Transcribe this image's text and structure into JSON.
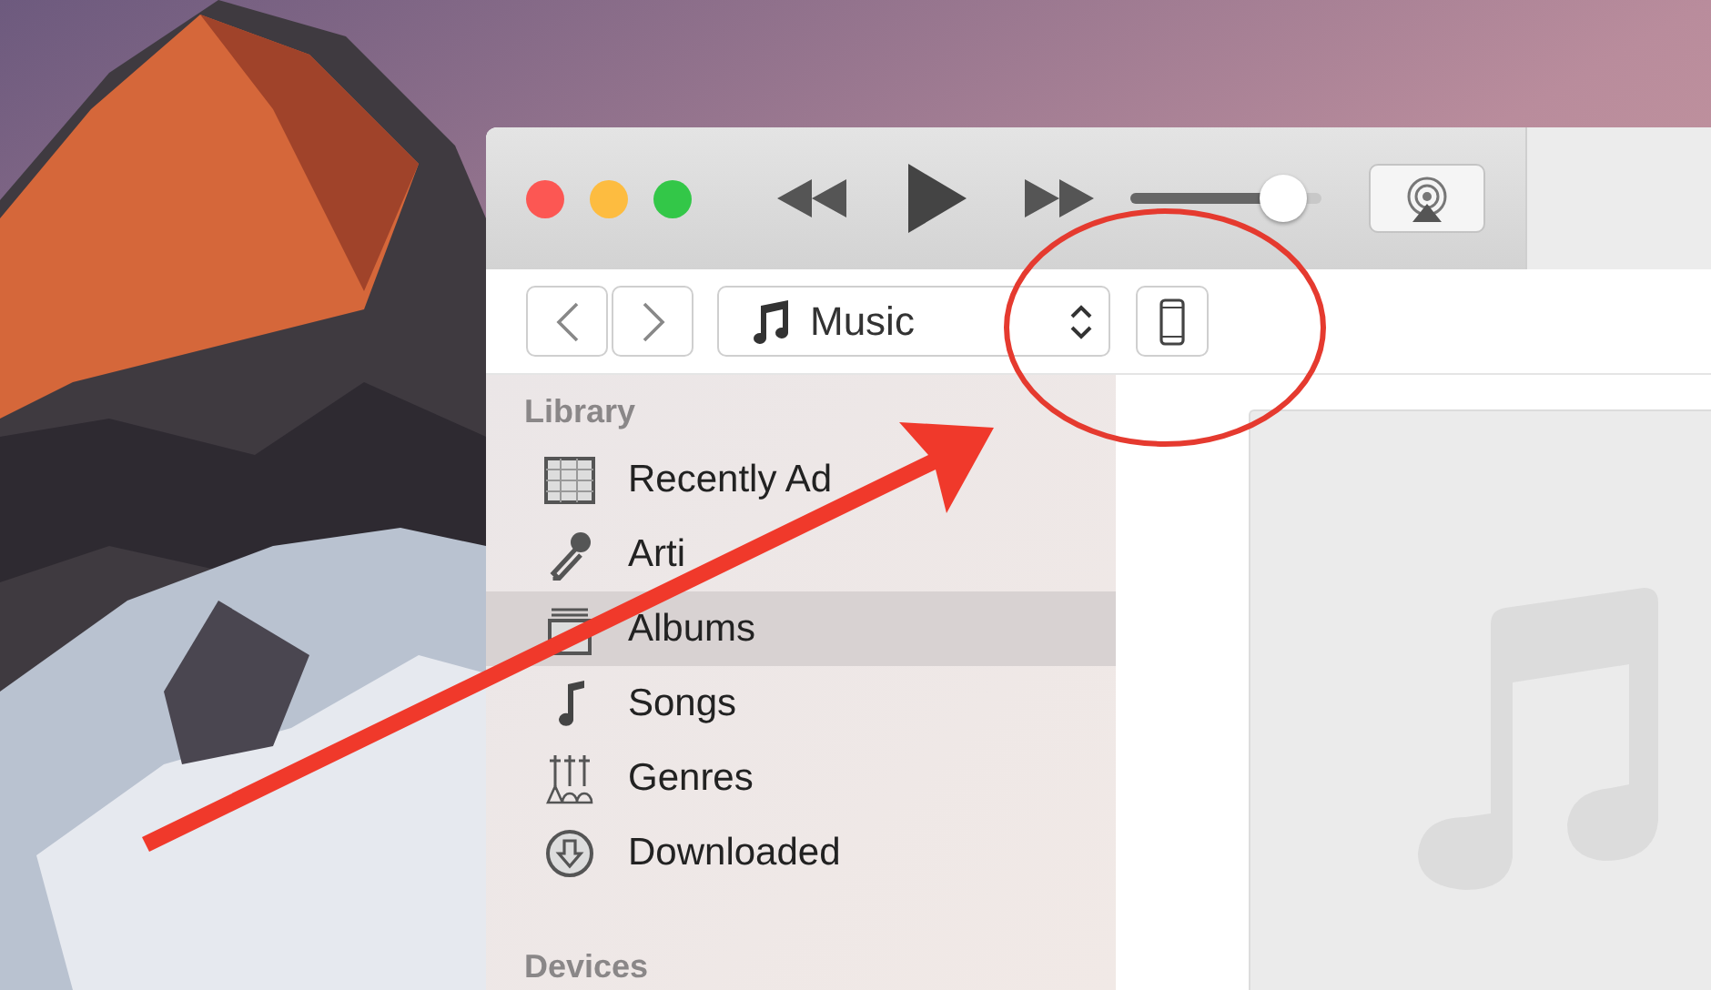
{
  "player": {
    "volume": {
      "level": 0.9
    }
  },
  "toolbar": {
    "source": {
      "label": "Music"
    }
  },
  "sidebar": {
    "sections": [
      {
        "title": "Library",
        "items": [
          {
            "label": "Recently Ad",
            "selected": false
          },
          {
            "label": "Arti",
            "selected": false
          },
          {
            "label": "Albums",
            "selected": true
          },
          {
            "label": "Songs",
            "selected": false
          },
          {
            "label": "Genres",
            "selected": false
          },
          {
            "label": "Downloaded",
            "selected": false
          }
        ]
      },
      {
        "title": "Devices"
      }
    ]
  }
}
